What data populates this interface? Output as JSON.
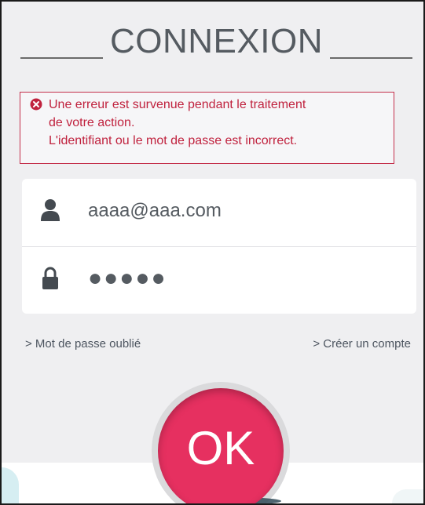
{
  "header": {
    "title": "CONNEXION"
  },
  "error": {
    "lines": [
      "Une erreur est survenue pendant le traitement",
      "de votre action.",
      "L'identifiant ou le mot de passe est incorrect."
    ]
  },
  "form": {
    "username_value": "aaaa@aaa.com",
    "password_value": "●●●●●"
  },
  "links": {
    "forgot_password": "> Mot de passe oublié",
    "create_account": "> Créer un compte"
  },
  "submit": {
    "label": "OK"
  },
  "colors": {
    "accent": "#e63060",
    "error": "#c0223e",
    "text": "#555b61",
    "background": "#efeff1"
  },
  "icons": {
    "error": "error-circle-icon",
    "user": "user-icon",
    "lock": "lock-icon"
  }
}
